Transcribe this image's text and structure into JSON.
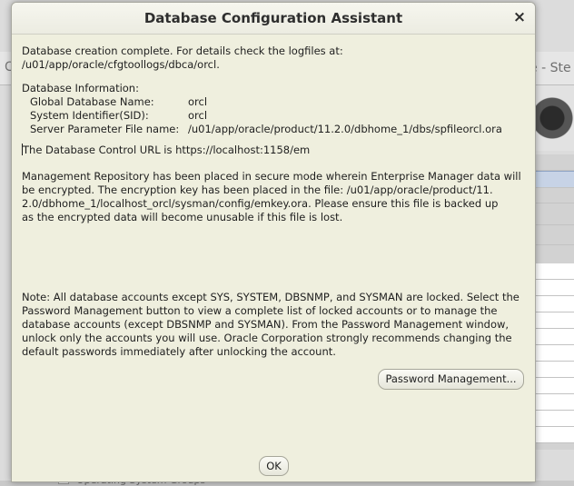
{
  "background": {
    "window_title_fragment": "e - Ste",
    "left_fragment": "C",
    "bottom_fragment": "Operating System Groups"
  },
  "dialog": {
    "title": "Database Configuration Assistant",
    "close_glyph": "×",
    "creation_line1": "Database creation complete. For details check the logfiles at:",
    "creation_line2": " /u01/app/oracle/cfgtoollogs/dbca/orcl.",
    "info_heading": "Database Information:",
    "info": [
      {
        "label": "Global Database Name:",
        "value": "orcl"
      },
      {
        "label": "System Identifier(SID):",
        "value": "orcl"
      },
      {
        "label": "Server Parameter File name:",
        "value": "/u01/app/oracle/product/11.2.0/dbhome_1/dbs/spfileorcl.ora"
      }
    ],
    "control_url_line": "The Database Control URL is https://localhost:1158/em",
    "repository_lines": [
      "Management Repository has been placed in secure mode wherein Enterprise Manager data will",
      "be encrypted.  The encryption key has been placed in the file: /u01/app/oracle/product/11.",
      "2.0/dbhome_1/localhost_orcl/sysman/config/emkey.ora.   Please ensure this file is backed up",
      "as the encrypted data will become unusable if this file is lost."
    ],
    "note_lines": [
      "Note: All database accounts except SYS, SYSTEM, DBSNMP, and SYSMAN are locked. Select the",
      "Password Management button to view a complete list of locked accounts or to manage the",
      "database accounts (except DBSNMP and SYSMAN). From the Password Management window,",
      "unlock only the accounts you will use. Oracle Corporation strongly recommends changing the",
      "default passwords immediately after unlocking the account."
    ],
    "password_button": "Password Management...",
    "ok_button": "OK"
  }
}
